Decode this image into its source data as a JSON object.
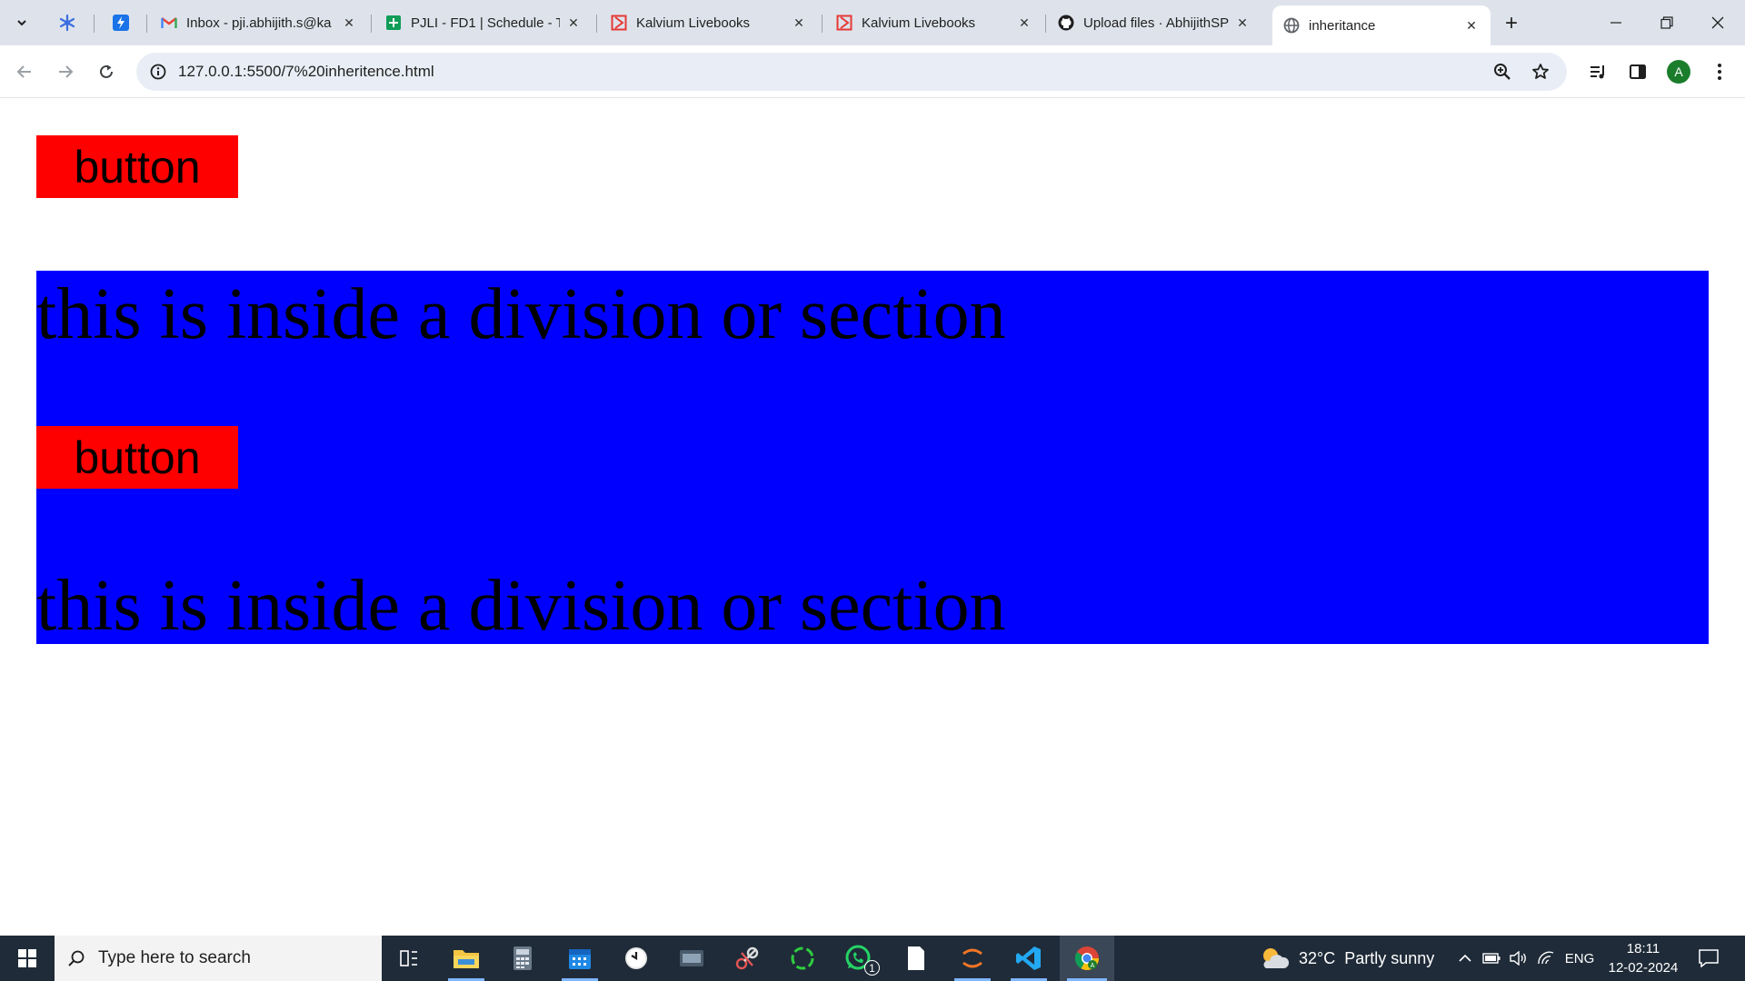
{
  "browser": {
    "tabs": [
      {
        "title": "Inbox - pji.abhijith.s@ka",
        "icon": "gmail-icon"
      },
      {
        "title": "PJLI - FD1 | Schedule - T",
        "icon": "sheets-icon"
      },
      {
        "title": "Kalvium Livebooks",
        "icon": "kalvium-icon"
      },
      {
        "title": "Kalvium Livebooks",
        "icon": "kalvium-icon"
      },
      {
        "title": "Upload files · AbhijithSP",
        "icon": "github-icon"
      },
      {
        "title": "inheritance",
        "icon": "globe-icon",
        "active": true
      }
    ],
    "url": "127.0.0.1:5500/7%20inheritence.html",
    "profile_initial": "A"
  },
  "page": {
    "button_top_label": "button",
    "section": {
      "paragraph_1": "this is inside a division or section",
      "button_label": "button",
      "paragraph_2": "this is inside a division or section"
    },
    "colors": {
      "button_bg": "#ff0000",
      "section_bg": "#0000ff"
    }
  },
  "taskbar": {
    "search_placeholder": "Type here to search",
    "weather": {
      "temp": "32°C",
      "condition": "Partly sunny"
    },
    "language": "ENG",
    "time": "18:11",
    "date": "12-02-2024",
    "whatsapp_badge": "1"
  }
}
